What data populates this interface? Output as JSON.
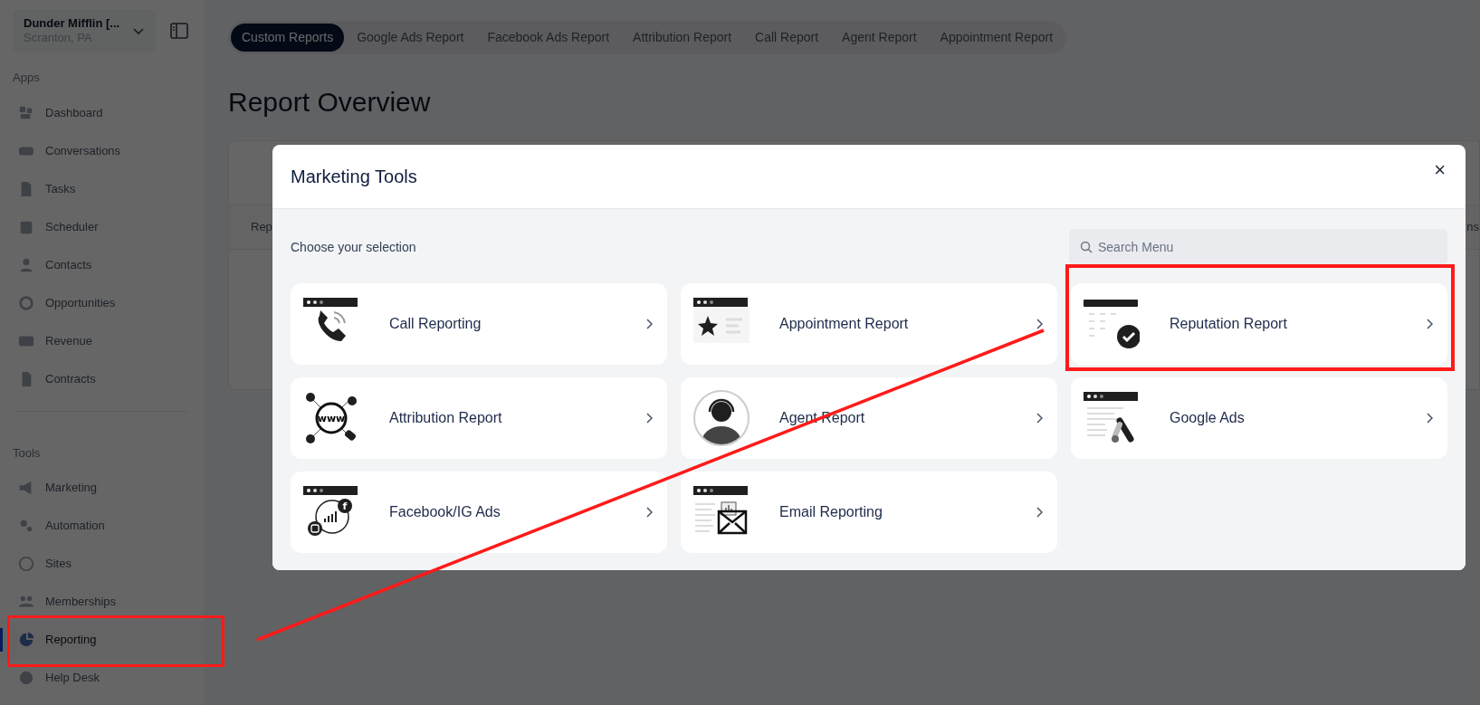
{
  "sidebar": {
    "account": {
      "name": "Dunder Mifflin [...",
      "location": "Scranton, PA"
    },
    "sections": [
      {
        "title": "Apps",
        "items": [
          {
            "label": "Dashboard",
            "selected": false,
            "annotated": false
          },
          {
            "label": "Conversations",
            "selected": false,
            "annotated": false
          },
          {
            "label": "Tasks",
            "selected": false,
            "annotated": false
          },
          {
            "label": "Scheduler",
            "selected": false,
            "annotated": false
          },
          {
            "label": "Contacts",
            "selected": false,
            "annotated": false
          },
          {
            "label": "Opportunities",
            "selected": false,
            "annotated": false
          },
          {
            "label": "Revenue",
            "selected": false,
            "annotated": false
          },
          {
            "label": "Contracts",
            "selected": false,
            "annotated": false
          }
        ]
      },
      {
        "title": "Tools",
        "items": [
          {
            "label": "Marketing",
            "selected": false,
            "annotated": false
          },
          {
            "label": "Automation",
            "selected": false,
            "annotated": false
          },
          {
            "label": "Sites",
            "selected": false,
            "annotated": false
          },
          {
            "label": "Memberships",
            "selected": false,
            "annotated": false
          },
          {
            "label": "Reporting",
            "selected": true,
            "annotated": true
          },
          {
            "label": "Help Desk",
            "selected": false,
            "annotated": false
          }
        ]
      }
    ]
  },
  "tabs": [
    {
      "label": "Custom Reports",
      "selected": true
    },
    {
      "label": "Google Ads Report",
      "selected": false
    },
    {
      "label": "Facebook Ads Report",
      "selected": false
    },
    {
      "label": "Attribution Report",
      "selected": false
    },
    {
      "label": "Call Report",
      "selected": false
    },
    {
      "label": "Agent Report",
      "selected": false
    },
    {
      "label": "Appointment Report",
      "selected": false
    }
  ],
  "page_title": "Report Overview",
  "background_table": {
    "column_1": "Rep",
    "column_2": "ns"
  },
  "modal": {
    "title": "Marketing Tools",
    "close": "×",
    "subtitle": "Choose your selection",
    "search": {
      "placeholder": "Search Menu"
    },
    "cards": [
      {
        "label": "Call Reporting",
        "annotated": false
      },
      {
        "label": "Appointment Report",
        "annotated": false
      },
      {
        "label": "Reputation Report",
        "annotated": true
      },
      {
        "label": "Attribution Report",
        "annotated": false,
        "icon_text": "www"
      },
      {
        "label": "Agent Report",
        "annotated": false
      },
      {
        "label": "Google Ads",
        "annotated": false
      },
      {
        "label": "Facebook/IG Ads",
        "annotated": false,
        "icon_text": "f"
      },
      {
        "label": "Email Reporting",
        "annotated": false
      }
    ]
  },
  "connector_line": true
}
